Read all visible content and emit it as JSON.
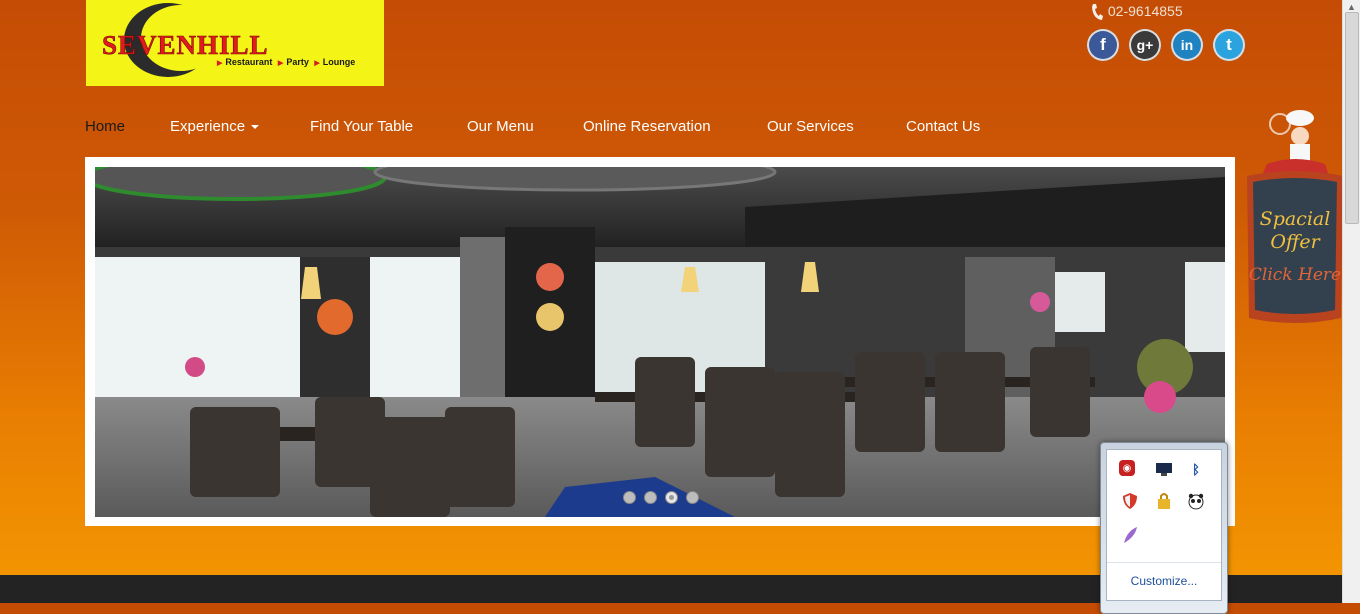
{
  "brand": {
    "name": "SEVENHILL",
    "tagline_parts": [
      "Restaurant",
      "Party",
      "Lounge"
    ],
    "logo_bg": "#f4f416",
    "logo_red": "#e21c1c"
  },
  "contact": {
    "phone": "02-9614855",
    "phone_icon": "phone-icon"
  },
  "social": [
    {
      "name": "facebook",
      "glyph": "f",
      "color": "#3b5998"
    },
    {
      "name": "google-plus",
      "glyph": "g+",
      "color": "#3a3a3a"
    },
    {
      "name": "linkedin",
      "glyph": "in",
      "color": "#1f83c2"
    },
    {
      "name": "twitter",
      "glyph": "t",
      "color": "#2aa3df"
    }
  ],
  "nav": {
    "items": [
      {
        "label": "Home",
        "active": true
      },
      {
        "label": "Experience",
        "dropdown": true
      },
      {
        "label": "Find Your Table"
      },
      {
        "label": "Our Menu"
      },
      {
        "label": "Online Reservation"
      },
      {
        "label": "Our Services"
      },
      {
        "label": "Contact Us"
      }
    ]
  },
  "slider": {
    "slide_count": 4,
    "active_index": 2
  },
  "offer": {
    "line1": "Spacial",
    "line2": "Offer",
    "line3": "Click Here"
  },
  "tray": {
    "icons": [
      "acrobat-icon",
      "monitor-icon",
      "bluetooth-icon",
      "shield-icon",
      "security-lock-icon",
      "panda-icon",
      "feather-icon"
    ],
    "customize_label": "Customize..."
  },
  "colors": {
    "bg_top": "#c44c05",
    "bg_bottom": "#f29302",
    "footer": "#232323"
  }
}
